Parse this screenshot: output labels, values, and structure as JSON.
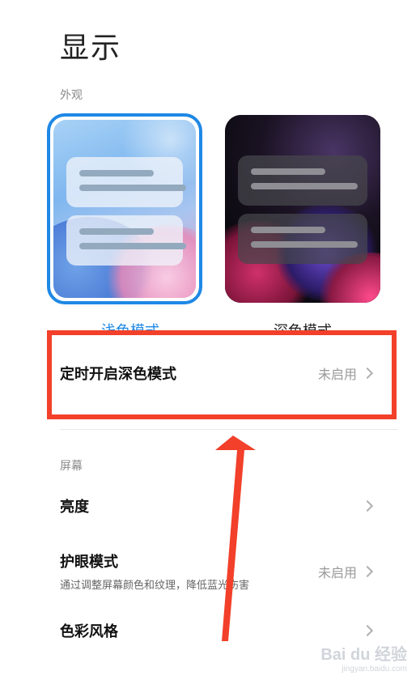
{
  "header": {
    "title": "显示"
  },
  "appearance": {
    "section_label": "外观",
    "light": {
      "label": "浅色模式",
      "selected": true
    },
    "dark": {
      "label": "深色模式",
      "selected": false
    }
  },
  "schedule_row": {
    "title": "定时开启深色模式",
    "value": "未启用"
  },
  "screen": {
    "section_label": "屏幕",
    "brightness": {
      "title": "亮度"
    },
    "eye_care": {
      "title": "护眼模式",
      "subtitle": "通过调整屏幕颜色和纹理，降低蓝光伤害",
      "value": "未启用"
    },
    "color_style": {
      "title": "色彩风格"
    }
  },
  "watermark": {
    "main": "Bai du 经验",
    "sub": "jingyan.baidu.com"
  },
  "colors": {
    "accent": "#1e88e5",
    "annotation": "#f2402a"
  }
}
